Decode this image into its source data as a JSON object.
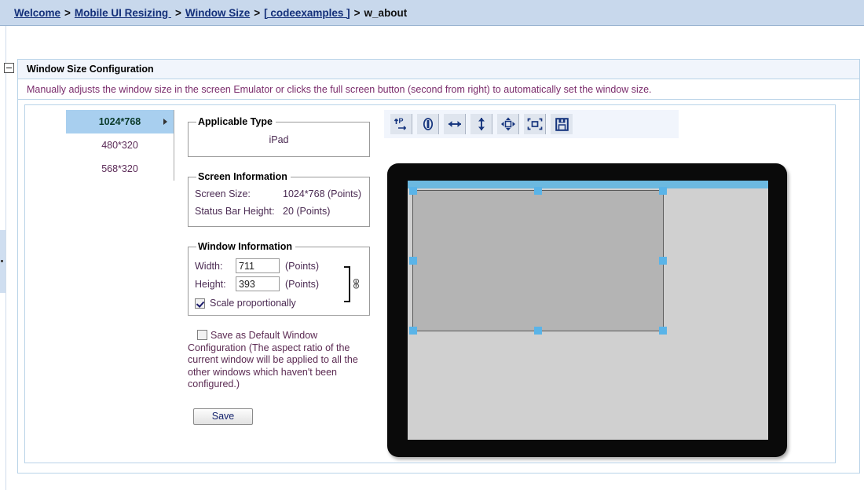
{
  "breadcrumb": {
    "separator": ">",
    "items": [
      {
        "label": "Welcome",
        "link": true
      },
      {
        "label": "Mobile UI Resizing ",
        "link": true
      },
      {
        "label": "Window Size",
        "link": true
      },
      {
        "label": "[ codeexamples ]",
        "link": true
      },
      {
        "label": "w_about",
        "link": false
      }
    ]
  },
  "panel": {
    "title": "Window Size Configuration",
    "description": "Manually adjusts the window size in the screen Emulator or clicks the full screen button (second from right) to automatically set the window size.",
    "collapse_icon": "minus-icon"
  },
  "resolution_list": {
    "items": [
      {
        "label": "1024*768",
        "selected": true
      },
      {
        "label": "480*320",
        "selected": false
      },
      {
        "label": "568*320",
        "selected": false
      }
    ]
  },
  "applicable_type": {
    "legend": "Applicable Type",
    "value": "iPad"
  },
  "screen_information": {
    "legend": "Screen Information",
    "rows": [
      {
        "label": "Screen Size:",
        "value": "1024*768 (Points)"
      },
      {
        "label": "Status Bar Height:",
        "value": "20 (Points)"
      }
    ]
  },
  "window_information": {
    "legend": "Window Information",
    "width_label": "Width:",
    "width_value": "711",
    "width_unit": "(Points)",
    "height_label": "Height:",
    "height_value": "393",
    "height_unit": "(Points)",
    "scale_label": "Scale proportionally",
    "scale_checked": true,
    "link_icon": "chain-link-icon"
  },
  "save_default": {
    "label": "Save as Default Window Configuration (The aspect ratio of the current window will be applied to all the other windows which haven't been configured.)",
    "checked": false
  },
  "save_button": {
    "label": "Save"
  },
  "toolbar": {
    "buttons": [
      {
        "icon": "rotate-portrait-icon",
        "title": "Portrait"
      },
      {
        "icon": "link-orientation-icon",
        "title": "Link"
      },
      {
        "icon": "resize-horizontal-icon",
        "title": "Resize width"
      },
      {
        "icon": "resize-vertical-icon",
        "title": "Resize height"
      },
      {
        "icon": "fit-to-window-icon",
        "title": "Fit to window"
      },
      {
        "icon": "full-screen-icon",
        "title": "Full screen"
      },
      {
        "icon": "save-floppy-icon",
        "title": "Save"
      }
    ]
  },
  "emulator": {
    "device": "ipad-frame",
    "status_bar_color": "#6cb9e0",
    "screen_color": "#d0d0d0",
    "window_color": "#b4b4b4",
    "handle_color": "#5ab4e8",
    "handles": [
      "nw",
      "n",
      "ne",
      "w",
      "e",
      "sw",
      "s",
      "se"
    ]
  },
  "colors": {
    "breadcrumb_bg": "#c8d8ec",
    "link": "#14307a",
    "panel_border": "#b9d3e8",
    "panel_header_bg": "#f1f5fc",
    "description_text": "#7a2b6b",
    "selected_row_bg": "#a8cfef"
  }
}
